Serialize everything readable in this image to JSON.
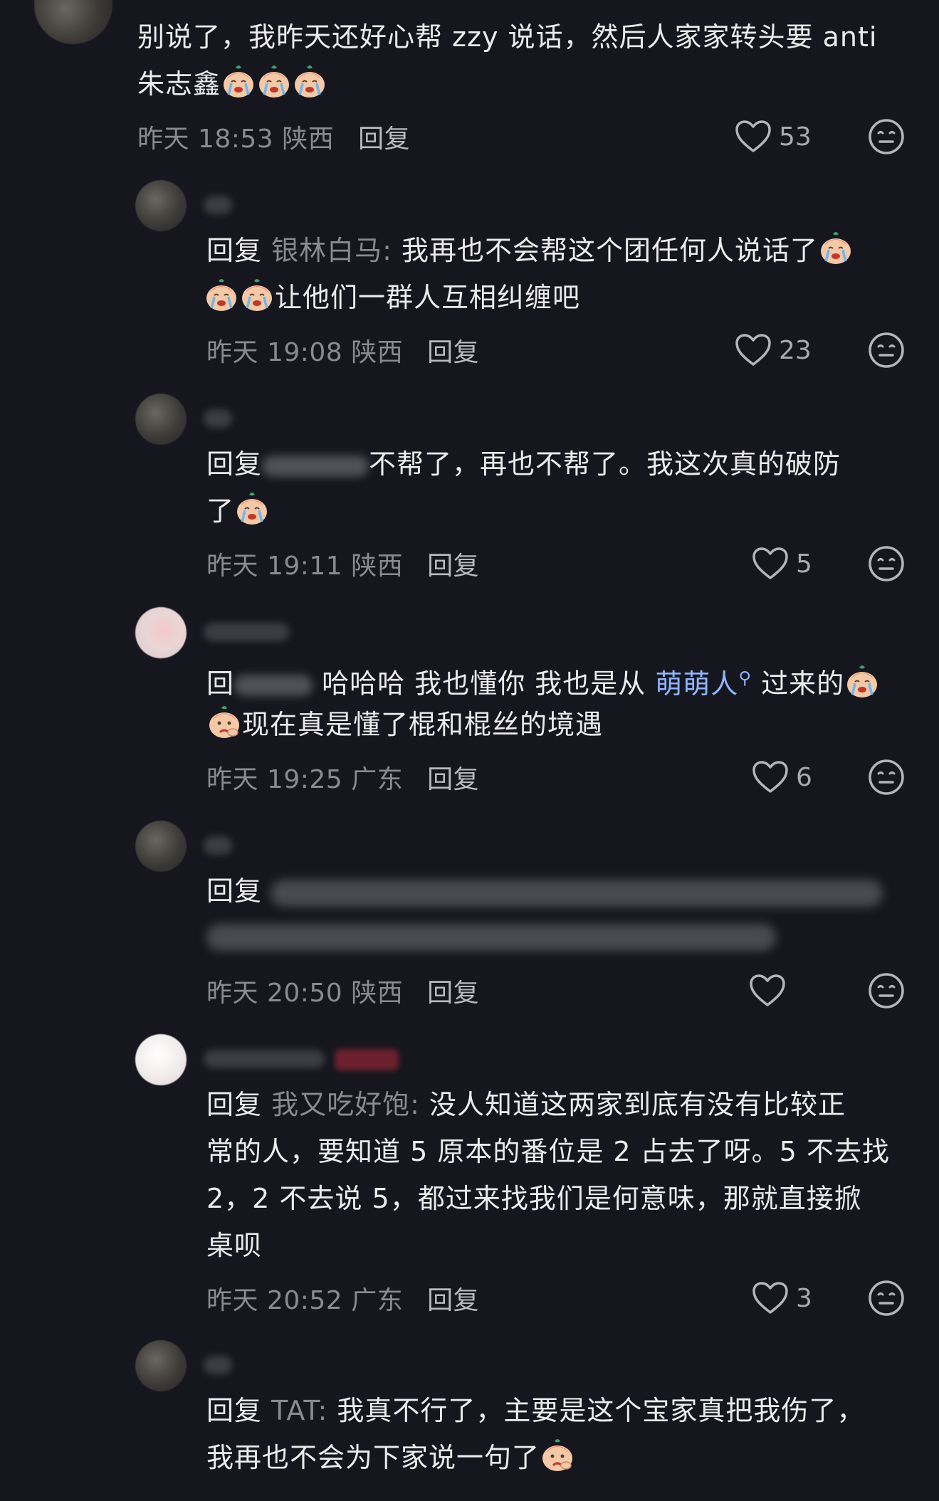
{
  "comments": [
    {
      "text_a": "别说了，我昨天还好心帮 zzy 说话，然后人家家转头要 anti",
      "text_b": "朱志鑫",
      "time": "昨天 18:53",
      "region": "陕西",
      "reply_label": "回复",
      "likes": "53"
    },
    {
      "reply_prefix": "回复",
      "reply_to": "银林白马:",
      "text_a": "我再也不会帮这个团任何人说话了",
      "text_b": "让他们一群人互相纠缠吧",
      "time": "昨天 19:08",
      "region": "陕西",
      "reply_label": "回复",
      "likes": "23"
    },
    {
      "reply_prefix": "回复",
      "text_a": "不帮了，再也不帮了。我这次真的破防",
      "text_b": "了",
      "time": "昨天 19:11",
      "region": "陕西",
      "reply_label": "回复",
      "likes": "5"
    },
    {
      "reply_prefix": "回",
      "text_a": "哈哈哈 我也懂你 我也是从",
      "link": "萌萌人",
      "text_a2": "过来的",
      "text_b": "现在真是懂了棍和棍丝的境遇",
      "time": "昨天 19:25",
      "region": "广东",
      "reply_label": "回复",
      "likes": "6"
    },
    {
      "reply_prefix": "回复",
      "time": "昨天 20:50",
      "region": "陕西",
      "reply_label": "回复",
      "likes": ""
    },
    {
      "reply_prefix": "回复",
      "reply_to": "我又吃好饱:",
      "text_a": "没人知道这两家到底有没有比较正",
      "text_b": "常的人，要知道 5 原本的番位是 2 占去了呀。5 不去找",
      "text_c": " 2，2 不去说 5，都过来找我们是何意味，那就直接掀",
      "text_d": "桌呗",
      "time": "昨天 20:52",
      "region": "广东",
      "reply_label": "回复",
      "likes": "3"
    },
    {
      "reply_prefix": "回复",
      "reply_to": "TAT:",
      "text_a": "我真不行了，主要是这个宝家真把我伤了，",
      "text_b": "我再也不会为下家说一句了"
    }
  ]
}
